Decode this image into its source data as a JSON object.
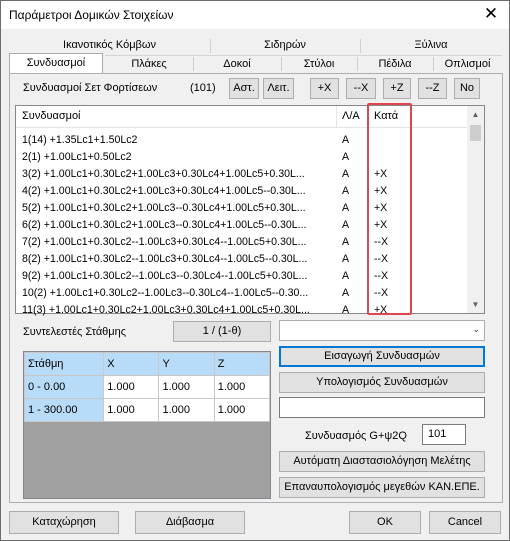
{
  "window": {
    "title": "Παράμετροι Δομικών Στοιχείων",
    "close_glyph": "✕"
  },
  "tabs_row1": [
    "Ικανοτικός Κόμβων",
    "Σιδηρών",
    "Ξύλινα"
  ],
  "tabs_row2": [
    "Συνδυασμοί",
    "Πλάκες",
    "Δοκοί",
    "Στύλοι",
    "Πέδιλα",
    "Οπλισμοί"
  ],
  "toolbar": {
    "label": "Συνδυασμοί Σετ Φορτίσεων",
    "count": "(101)",
    "btn_ast": "Αστ.",
    "btn_leit": "Λειτ.",
    "btn_px": "+X",
    "btn_mx": "--X",
    "btn_pz": "+Z",
    "btn_mz": "--Z",
    "btn_no": "No"
  },
  "list": {
    "headers": [
      "Συνδυασμοί",
      "Λ/Α",
      "Κατά"
    ],
    "rows": [
      {
        "combo": "1(14) +1.35Lc1+1.50Lc2",
        "la": "A",
        "kata": ""
      },
      {
        "combo": "2(1) +1.00Lc1+0.50Lc2",
        "la": "A",
        "kata": ""
      },
      {
        "combo": "3(2) +1.00Lc1+0.30Lc2+1.00Lc3+0.30Lc4+1.00Lc5+0.30L...",
        "la": "A",
        "kata": "+X"
      },
      {
        "combo": "4(2) +1.00Lc1+0.30Lc2+1.00Lc3+0.30Lc4+1.00Lc5--0.30L...",
        "la": "A",
        "kata": "+X"
      },
      {
        "combo": "5(2) +1.00Lc1+0.30Lc2+1.00Lc3--0.30Lc4+1.00Lc5+0.30L...",
        "la": "A",
        "kata": "+X"
      },
      {
        "combo": "6(2) +1.00Lc1+0.30Lc2+1.00Lc3--0.30Lc4+1.00Lc5--0.30L...",
        "la": "A",
        "kata": "+X"
      },
      {
        "combo": "7(2) +1.00Lc1+0.30Lc2--1.00Lc3+0.30Lc4--1.00Lc5+0.30L...",
        "la": "A",
        "kata": "--X"
      },
      {
        "combo": "8(2) +1.00Lc1+0.30Lc2--1.00Lc3+0.30Lc4--1.00Lc5--0.30L...",
        "la": "A",
        "kata": "--X"
      },
      {
        "combo": "9(2) +1.00Lc1+0.30Lc2--1.00Lc3--0.30Lc4--1.00Lc5+0.30L...",
        "la": "A",
        "kata": "--X"
      },
      {
        "combo": "10(2) +1.00Lc1+0.30Lc2--1.00Lc3--0.30Lc4--1.00Lc5--0.30...",
        "la": "A",
        "kata": "--X"
      },
      {
        "combo": "11(3) +1.00Lc1+0.30Lc2+1.00Lc3+0.30Lc4+1.00Lc5+0.30L...",
        "la": "A",
        "kata": "+X"
      }
    ]
  },
  "weights": {
    "label": "Συντελεστές Στάθμης",
    "button": "1 / (1-θ)"
  },
  "grid": {
    "headers": [
      "Στάθμη",
      "X",
      "Y",
      "Z"
    ],
    "rows": [
      [
        "0 - 0.00",
        "1.000",
        "1.000",
        "1.000"
      ],
      [
        "1 - 300.00",
        "1.000",
        "1.000",
        "1.000"
      ]
    ]
  },
  "right_panel": {
    "combo_value": "",
    "btn_import": "Εισαγωγή Συνδυασμών",
    "btn_calc": "Υπολογισμός Συνδυασμών",
    "text_value": "",
    "gpsi_label": "Συνδυασμός G+ψ2Q",
    "gpsi_value": "101",
    "btn_auto": "Αυτόματη Διαστασιολόγηση Μελέτης",
    "btn_recalc": "Επαναυπολογισμός μεγεθών ΚΑΝ.ΕΠΕ."
  },
  "footer": {
    "save": "Καταχώρηση",
    "read": "Διάβασμα",
    "ok": "OK",
    "cancel": "Cancel"
  },
  "colors": {
    "highlight": "#e0474c",
    "grid_header": "#b8dcf7",
    "focus": "#0078d7"
  }
}
